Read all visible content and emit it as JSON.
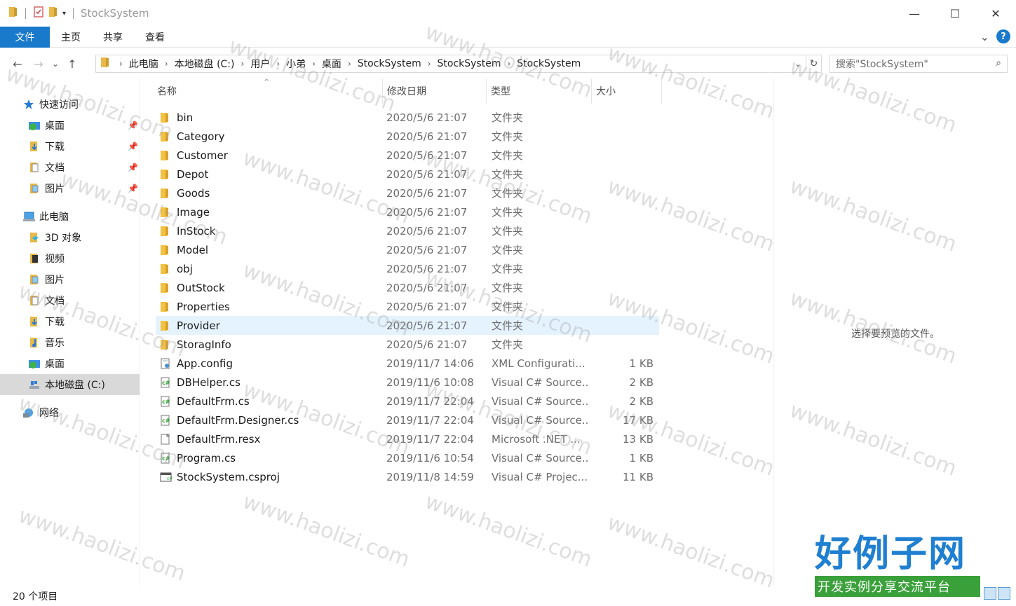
{
  "window": {
    "title": "StockSystem",
    "minimize_icon": "—",
    "maximize_icon": "☐",
    "close_icon": "✕"
  },
  "ribbon": {
    "tabs": [
      "文件",
      "主页",
      "共享",
      "查看"
    ],
    "expand_icon": "⌄",
    "help_icon": "?"
  },
  "nav": {
    "back_icon": "←",
    "forward_icon": "→",
    "recent_icon": "⌄",
    "up_icon": "↑",
    "breadcrumbs": [
      "此电脑",
      "本地磁盘 (C:)",
      "用户",
      "小弟",
      "桌面",
      "StockSystem",
      "StockSystem",
      "StockSystem"
    ],
    "crumb_separator": "›",
    "dropdown_icon": "⌄",
    "refresh_icon": "↻",
    "search_placeholder": "搜索\"StockSystem\"",
    "search_icon": "⌕"
  },
  "sidebar": {
    "quick_access": "快速访问",
    "quick_items": [
      "桌面",
      "下载",
      "文档",
      "图片"
    ],
    "pin_icon": "📌",
    "this_pc": "此电脑",
    "pc_items": [
      "3D 对象",
      "视频",
      "图片",
      "文档",
      "下载",
      "音乐",
      "桌面",
      "本地磁盘 (C:)"
    ],
    "network": "网络"
  },
  "columns": {
    "name": "名称",
    "date": "修改日期",
    "type": "类型",
    "size": "大小",
    "sort_icon": "^"
  },
  "files": [
    {
      "name": "bin",
      "date": "2020/5/6 21:07",
      "type": "文件夹",
      "size": "",
      "icon": "folder"
    },
    {
      "name": "Category",
      "date": "2020/5/6 21:07",
      "type": "文件夹",
      "size": "",
      "icon": "folder"
    },
    {
      "name": "Customer",
      "date": "2020/5/6 21:07",
      "type": "文件夹",
      "size": "",
      "icon": "folder"
    },
    {
      "name": "Depot",
      "date": "2020/5/6 21:07",
      "type": "文件夹",
      "size": "",
      "icon": "folder"
    },
    {
      "name": "Goods",
      "date": "2020/5/6 21:07",
      "type": "文件夹",
      "size": "",
      "icon": "folder"
    },
    {
      "name": "Image",
      "date": "2020/5/6 21:07",
      "type": "文件夹",
      "size": "",
      "icon": "folder"
    },
    {
      "name": "InStock",
      "date": "2020/5/6 21:07",
      "type": "文件夹",
      "size": "",
      "icon": "folder"
    },
    {
      "name": "Model",
      "date": "2020/5/6 21:07",
      "type": "文件夹",
      "size": "",
      "icon": "folder"
    },
    {
      "name": "obj",
      "date": "2020/5/6 21:07",
      "type": "文件夹",
      "size": "",
      "icon": "folder"
    },
    {
      "name": "OutStock",
      "date": "2020/5/6 21:07",
      "type": "文件夹",
      "size": "",
      "icon": "folder"
    },
    {
      "name": "Properties",
      "date": "2020/5/6 21:07",
      "type": "文件夹",
      "size": "",
      "icon": "folder"
    },
    {
      "name": "Provider",
      "date": "2020/5/6 21:07",
      "type": "文件夹",
      "size": "",
      "icon": "folder"
    },
    {
      "name": "StoragInfo",
      "date": "2020/5/6 21:07",
      "type": "文件夹",
      "size": "",
      "icon": "folder"
    },
    {
      "name": "App.config",
      "date": "2019/11/7 14:06",
      "type": "XML Configurati...",
      "size": "1 KB",
      "icon": "config"
    },
    {
      "name": "DBHelper.cs",
      "date": "2019/11/6 10:08",
      "type": "Visual C# Source...",
      "size": "2 KB",
      "icon": "cs"
    },
    {
      "name": "DefaultFrm.cs",
      "date": "2019/11/7 22:04",
      "type": "Visual C# Source...",
      "size": "2 KB",
      "icon": "cs"
    },
    {
      "name": "DefaultFrm.Designer.cs",
      "date": "2019/11/7 22:04",
      "type": "Visual C# Source...",
      "size": "17 KB",
      "icon": "cs"
    },
    {
      "name": "DefaultFrm.resx",
      "date": "2019/11/7 22:04",
      "type": "Microsoft .NET ...",
      "size": "13 KB",
      "icon": "resx"
    },
    {
      "name": "Program.cs",
      "date": "2019/11/6 10:54",
      "type": "Visual C# Source...",
      "size": "1 KB",
      "icon": "cs"
    },
    {
      "name": "StockSystem.csproj",
      "date": "2019/11/8 14:59",
      "type": "Visual C# Projec...",
      "size": "11 KB",
      "icon": "csproj"
    }
  ],
  "preview": {
    "message": "选择要预览的文件。"
  },
  "status": {
    "count": "20 个项目"
  },
  "watermark": {
    "text": "www.haolizi.com",
    "brand_big": "好例子网",
    "brand_small": "开发实例分享交流平台"
  },
  "colors": {
    "accent": "#1979ca",
    "folder": "#e8b94a",
    "hover_row": "#e5f3ff",
    "selected_nav": "#d9d9d9"
  }
}
